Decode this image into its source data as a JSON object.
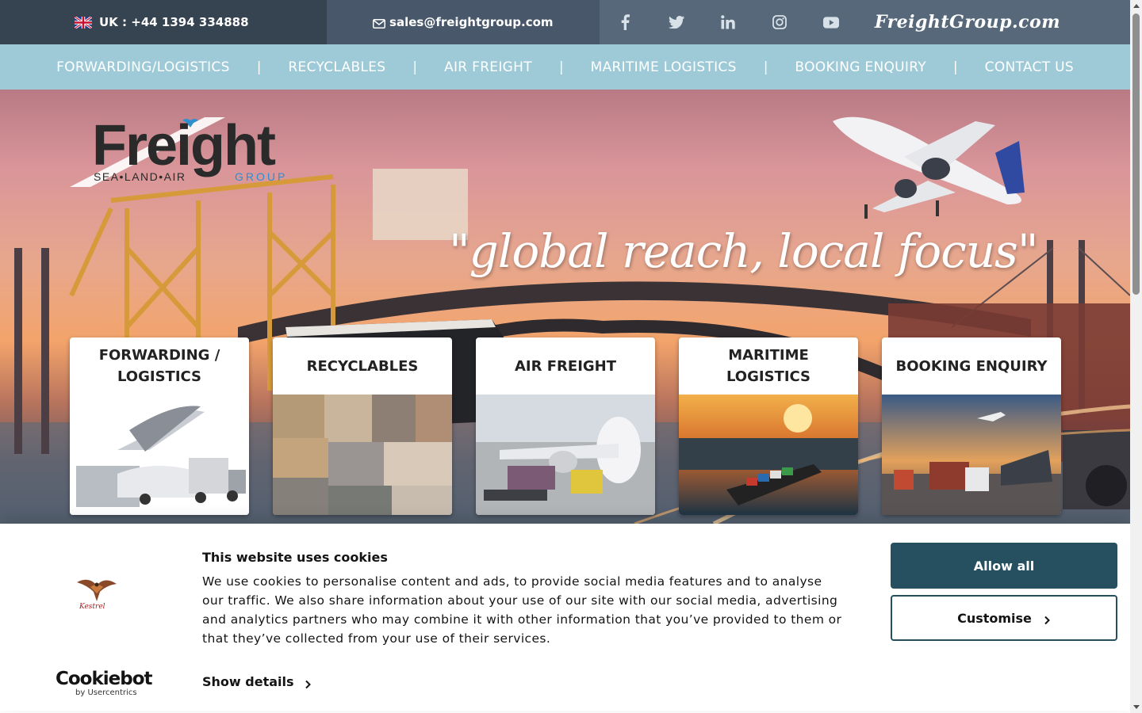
{
  "topbar": {
    "phone": "UK : +44 1394 334888",
    "email": "sales@freightgroup.com",
    "brand": "FreightGroup.com",
    "social_icons": [
      "facebook-icon",
      "twitter-icon",
      "linkedin-icon",
      "instagram-icon",
      "youtube-icon"
    ]
  },
  "nav": {
    "separator": "|",
    "items": [
      {
        "label": "FORWARDING/LOGISTICS"
      },
      {
        "label": "RECYCLABLES"
      },
      {
        "label": "AIR FREIGHT"
      },
      {
        "label": "MARITIME LOGISTICS"
      },
      {
        "label": "BOOKING ENQUIRY"
      },
      {
        "label": "CONTACT US"
      }
    ]
  },
  "hero": {
    "logo": {
      "word": "Freight",
      "left": "SEA•LAND•AIR",
      "right": "GROUP"
    },
    "tagline": "\"global reach, local focus\""
  },
  "cards": [
    {
      "title": "FORWARDING / LOGISTICS"
    },
    {
      "title": "RECYCLABLES"
    },
    {
      "title": "AIR FREIGHT"
    },
    {
      "title": "MARITIME LOGISTICS"
    },
    {
      "title": "BOOKING ENQUIRY"
    }
  ],
  "cookie": {
    "title": "This website uses cookies",
    "body": "We use cookies to personalise content and ads, to provide social media features and to analyse our traffic. We also share information about your use of our site with our social media, advertising and analytics partners who may combine it with other information that you’ve provided to them or that they’ve collected from your use of their services.",
    "show_details": "Show details",
    "allow_all": "Allow all",
    "customise": "Customise",
    "provider_name": "Cookiebot",
    "provider_sub": "by Usercentrics",
    "site_logo_text": "Kestrel"
  },
  "colors": {
    "topbar_phone_bg": "#364452",
    "topbar_email_bg": "#48586a",
    "topbar_social_bg": "#566879",
    "nav_bg": "#9ecad8",
    "cookie_primary": "#26505f"
  }
}
